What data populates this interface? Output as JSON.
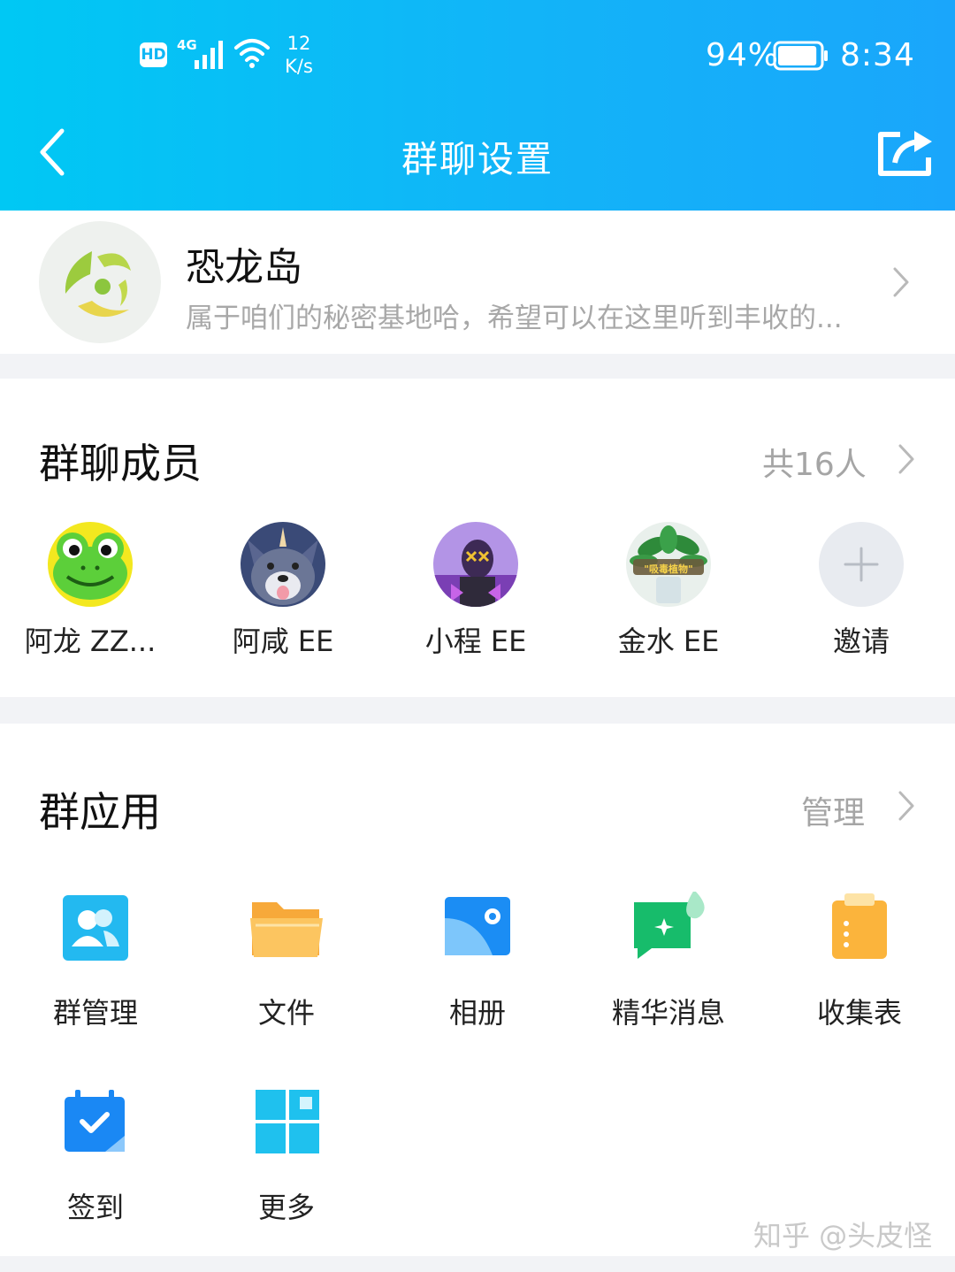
{
  "status_bar": {
    "hd": "HD",
    "network": "4G",
    "speed_value": "12",
    "speed_unit": "K/s",
    "battery_pct": "94%",
    "battery_level": 0.94,
    "time": "8:34"
  },
  "header": {
    "title": "群聊设置"
  },
  "group": {
    "name": "恐龙岛",
    "description": "属于咱们的秘密基地哈，希望可以在这里听到丰收的..."
  },
  "members_section": {
    "title": "群聊成员",
    "count_label": "共16人",
    "members": [
      {
        "name": "阿龙  ZZ..."
      },
      {
        "name": "阿咸  EE"
      },
      {
        "name": "小程  EE"
      },
      {
        "name": "金水 EE"
      }
    ],
    "avatar_caption": "\"吸毒植物\"",
    "invite_label": "邀请"
  },
  "apps_section": {
    "title": "群应用",
    "manage_label": "管理",
    "apps": [
      {
        "label": "群管理",
        "icon": "group-manage-icon",
        "color": "#20b8f2"
      },
      {
        "label": "文件",
        "icon": "folder-icon",
        "color": "#f9b94d"
      },
      {
        "label": "相册",
        "icon": "album-icon",
        "color": "#1c8ef5"
      },
      {
        "label": "精华消息",
        "icon": "essence-message-icon",
        "color": "#17bf6f"
      },
      {
        "label": "收集表",
        "icon": "clipboard-icon",
        "color": "#fbba47"
      },
      {
        "label": "签到",
        "icon": "calendar-check-icon",
        "color": "#1a89f5"
      },
      {
        "label": "更多",
        "icon": "grid-more-icon",
        "color": "#1ec3f0"
      }
    ]
  },
  "watermark": "知乎 @头皮怪"
}
